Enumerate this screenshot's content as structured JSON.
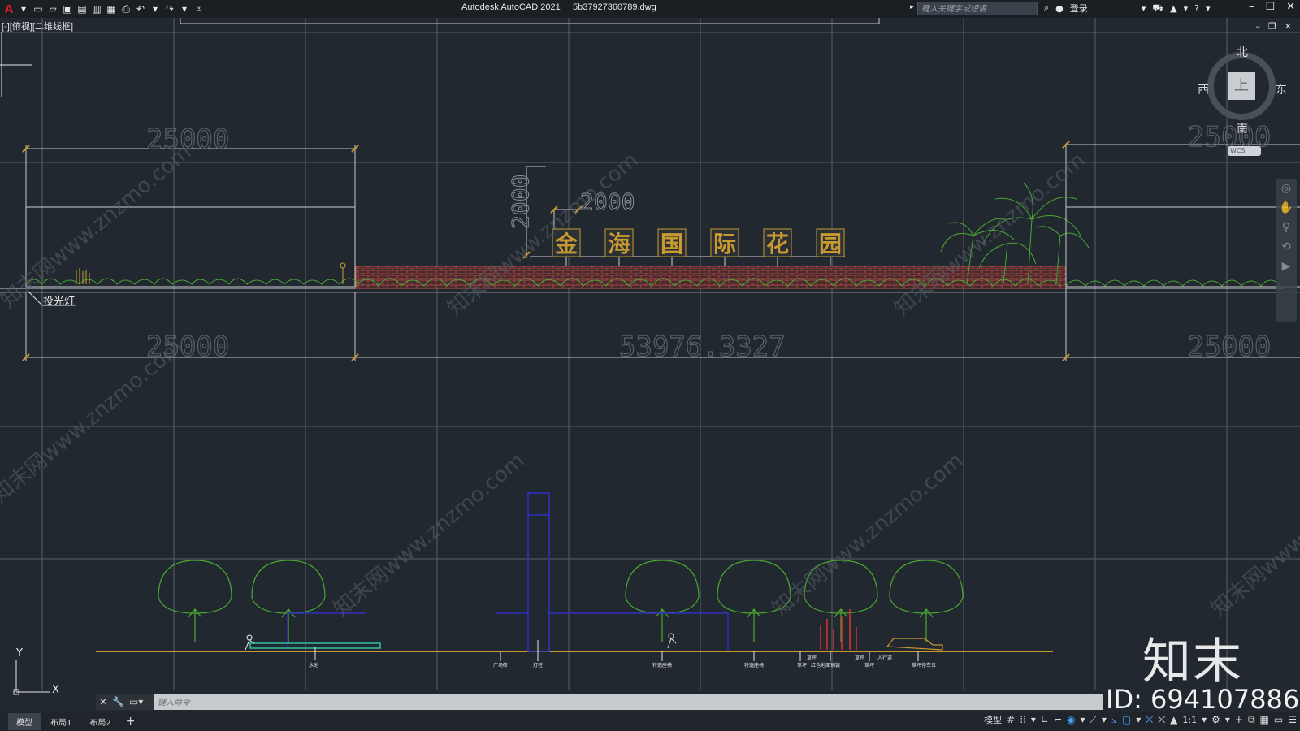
{
  "app": {
    "title": "Autodesk AutoCAD 2021     5b37927360789.dwg",
    "logo_letter": "A",
    "search_placeholder": "键入关键字或短语",
    "login_label": "登录"
  },
  "viewport": {
    "label": "[-][俯视][二维线框]"
  },
  "viewcube": {
    "north": "北",
    "south": "南",
    "east": "东",
    "west": "西",
    "face": "上",
    "wcs": "WCS"
  },
  "drawing": {
    "dims": {
      "left_top": "25000",
      "left_bottom": "25000",
      "right_top": "25000",
      "right_bottom": "25000",
      "center_bottom": "53976.3327",
      "sign_height": "2000",
      "sign_width": "2000"
    },
    "sign_chars": [
      "金",
      "海",
      "国",
      "际",
      "花",
      "园"
    ],
    "callout": "投光灯",
    "plan_labels": [
      "水池",
      "广场砖",
      "灯柱",
      "特选座椅",
      "特选座椅",
      "草坪",
      "草坪",
      "红色地面铺装",
      "草坪",
      "草坪",
      "人行道",
      "草坪停车位"
    ],
    "watermark": "知末网www.znzmo.com"
  },
  "ucs": {
    "x": "X",
    "y": "Y"
  },
  "command": {
    "placeholder": "键入命令"
  },
  "tabs": [
    "模型",
    "布局1",
    "布局2"
  ],
  "status": {
    "model_label": "模型",
    "scale": "1:1"
  },
  "watermark": {
    "brand": "知末",
    "id": "ID: 694107886"
  }
}
